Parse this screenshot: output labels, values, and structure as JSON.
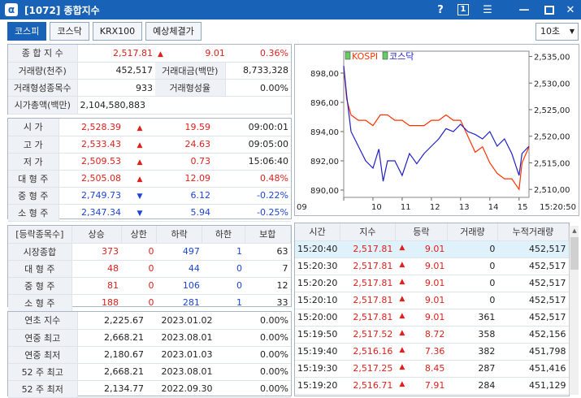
{
  "window": {
    "title": "[1072] 종합지수",
    "help": "?",
    "page_indicator": "1"
  },
  "tabs": [
    "코스피",
    "코스닥",
    "KRX100",
    "예상체결가"
  ],
  "interval": {
    "value": "10초"
  },
  "summary": {
    "row1": {
      "label": "종 합 지 수",
      "value": "2,517.81",
      "change": "9.01",
      "pct": "0.36%"
    },
    "row2": {
      "label": "거래량(천주)",
      "value": "452,517",
      "label2": "거래대금(백만)",
      "value2": "8,733,328"
    },
    "row3": {
      "label": "거래형성종목수",
      "value": "933",
      "label2": "거래형성율",
      "value2": "0.00%"
    },
    "row4": {
      "label": "시가총액(백만)",
      "value": "2,104,580,883"
    }
  },
  "prices": [
    {
      "label": "시    가",
      "value": "2,528.39",
      "dir": "up",
      "change": "19.59",
      "extra": "09:00:01",
      "color": "red"
    },
    {
      "label": "고    가",
      "value": "2,533.43",
      "dir": "up",
      "change": "24.63",
      "extra": "09:05:00",
      "color": "red"
    },
    {
      "label": "저    가",
      "value": "2,509.53",
      "dir": "up",
      "change": "0.73",
      "extra": "15:06:40",
      "color": "red"
    },
    {
      "label": "대 형 주",
      "value": "2,505.08",
      "dir": "up",
      "change": "12.09",
      "extra": "0.48%",
      "color": "red"
    },
    {
      "label": "중 형 주",
      "value": "2,749.73",
      "dir": "down",
      "change": "6.12",
      "extra": "-0.22%",
      "color": "blue"
    },
    {
      "label": "소 형 주",
      "value": "2,347.34",
      "dir": "down",
      "change": "5.94",
      "extra": "-0.25%",
      "color": "blue"
    }
  ],
  "breadth": {
    "headers": [
      "[등락종목수]",
      "상승",
      "상한",
      "하락",
      "하한",
      "보합"
    ],
    "rows": [
      {
        "label": "시장종합",
        "up": "373",
        "uplimit": "0",
        "down": "497",
        "downlimit": "1",
        "flat": "63"
      },
      {
        "label": "대 형 주",
        "up": "48",
        "uplimit": "0",
        "down": "44",
        "downlimit": "0",
        "flat": "7"
      },
      {
        "label": "중 형 주",
        "up": "81",
        "uplimit": "0",
        "down": "106",
        "downlimit": "0",
        "flat": "12"
      },
      {
        "label": "소 형 주",
        "up": "188",
        "uplimit": "0",
        "down": "281",
        "downlimit": "1",
        "flat": "33"
      }
    ]
  },
  "yearly": [
    {
      "label": "연초  지수",
      "value": "2,225.67",
      "date": "2023.01.02",
      "pct": "0.00%"
    },
    {
      "label": "연중  최고",
      "value": "2,668.21",
      "date": "2023.08.01",
      "pct": "0.00%"
    },
    {
      "label": "연중  최저",
      "value": "2,180.67",
      "date": "2023.01.03",
      "pct": "0.00%"
    },
    {
      "label": "52 주 최고",
      "value": "2,668.21",
      "date": "2023.08.01",
      "pct": "0.00%"
    },
    {
      "label": "52 주 최저",
      "value": "2,134.77",
      "date": "2022.09.30",
      "pct": "0.00%"
    }
  ],
  "ticks": {
    "headers": [
      "시간",
      "지수",
      "등락",
      "거래량",
      "누적거래량"
    ],
    "rows": [
      {
        "time": "15:20:40",
        "index": "2,517.81",
        "change": "9.01",
        "vol": "0",
        "cum": "452,517"
      },
      {
        "time": "15:20:30",
        "index": "2,517.81",
        "change": "9.01",
        "vol": "0",
        "cum": "452,517"
      },
      {
        "time": "15:20:20",
        "index": "2,517.81",
        "change": "9.01",
        "vol": "0",
        "cum": "452,517"
      },
      {
        "time": "15:20:10",
        "index": "2,517.81",
        "change": "9.01",
        "vol": "0",
        "cum": "452,517"
      },
      {
        "time": "15:20:00",
        "index": "2,517.81",
        "change": "9.01",
        "vol": "361",
        "cum": "452,517"
      },
      {
        "time": "15:19:50",
        "index": "2,517.52",
        "change": "8.72",
        "vol": "358",
        "cum": "452,156"
      },
      {
        "time": "15:19:40",
        "index": "2,516.16",
        "change": "7.36",
        "vol": "382",
        "cum": "451,798"
      },
      {
        "time": "15:19:30",
        "index": "2,517.25",
        "change": "8.45",
        "vol": "287",
        "cum": "451,416"
      },
      {
        "time": "15:19:20",
        "index": "2,516.71",
        "change": "7.91",
        "vol": "284",
        "cum": "451,129"
      }
    ]
  },
  "colors": {
    "titlebar": "#1863b8",
    "kospi": "#ff3300",
    "kosdaq": "#2020c8",
    "up": "#e0201c",
    "down": "#1c45d8"
  },
  "chart_data": {
    "type": "line",
    "legend": [
      "KOSPI",
      "코스닥"
    ],
    "x_ticks": [
      "09",
      "10",
      "11",
      "12",
      "13",
      "14",
      "15"
    ],
    "x_end_label": "15:20:50",
    "y_left_ticks": [
      "898,00",
      "896,00",
      "894,00",
      "892,00",
      "890,00"
    ],
    "y_right_ticks": [
      "2,535,00",
      "2,530,00",
      "2,525,00",
      "2,520,00",
      "2,515,00",
      "2,510,00"
    ],
    "ylim_left": [
      889.5,
      899.5
    ],
    "ylim_right": [
      2508.5,
      2536.0
    ],
    "series": [
      {
        "name": "KOSPI",
        "axis": "right",
        "points": [
          [
            9.0,
            2533
          ],
          [
            9.1,
            2527
          ],
          [
            9.25,
            2524
          ],
          [
            9.5,
            2523
          ],
          [
            9.75,
            2523
          ],
          [
            10.0,
            2522
          ],
          [
            10.25,
            2524
          ],
          [
            10.5,
            2524
          ],
          [
            10.75,
            2523
          ],
          [
            11.0,
            2523
          ],
          [
            11.25,
            2522
          ],
          [
            11.5,
            2522
          ],
          [
            11.75,
            2522
          ],
          [
            12.0,
            2523
          ],
          [
            12.25,
            2523
          ],
          [
            12.5,
            2524
          ],
          [
            12.75,
            2523
          ],
          [
            13.0,
            2523
          ],
          [
            13.25,
            2520
          ],
          [
            13.5,
            2517
          ],
          [
            13.75,
            2518
          ],
          [
            14.0,
            2515
          ],
          [
            14.25,
            2513
          ],
          [
            14.5,
            2512
          ],
          [
            14.75,
            2512
          ],
          [
            15.0,
            2510
          ],
          [
            15.1,
            2515
          ],
          [
            15.34,
            2518
          ]
        ]
      },
      {
        "name": "코스닥",
        "axis": "left",
        "points": [
          [
            9.0,
            898.5
          ],
          [
            9.1,
            896.5
          ],
          [
            9.25,
            894.0
          ],
          [
            9.5,
            893.0
          ],
          [
            9.75,
            892.0
          ],
          [
            10.0,
            891.5
          ],
          [
            10.2,
            892.8
          ],
          [
            10.35,
            890.6
          ],
          [
            10.5,
            892.0
          ],
          [
            10.75,
            892.0
          ],
          [
            11.0,
            891.0
          ],
          [
            11.25,
            892.5
          ],
          [
            11.5,
            891.8
          ],
          [
            11.75,
            892.5
          ],
          [
            12.0,
            893.0
          ],
          [
            12.25,
            893.5
          ],
          [
            12.5,
            894.2
          ],
          [
            12.75,
            894.0
          ],
          [
            13.0,
            894.5
          ],
          [
            13.25,
            894.0
          ],
          [
            13.5,
            893.8
          ],
          [
            13.75,
            893.5
          ],
          [
            14.0,
            894.0
          ],
          [
            14.25,
            893.0
          ],
          [
            14.5,
            893.5
          ],
          [
            14.75,
            892.5
          ],
          [
            15.0,
            891.0
          ],
          [
            15.1,
            892.5
          ],
          [
            15.34,
            893.0
          ]
        ]
      }
    ]
  }
}
